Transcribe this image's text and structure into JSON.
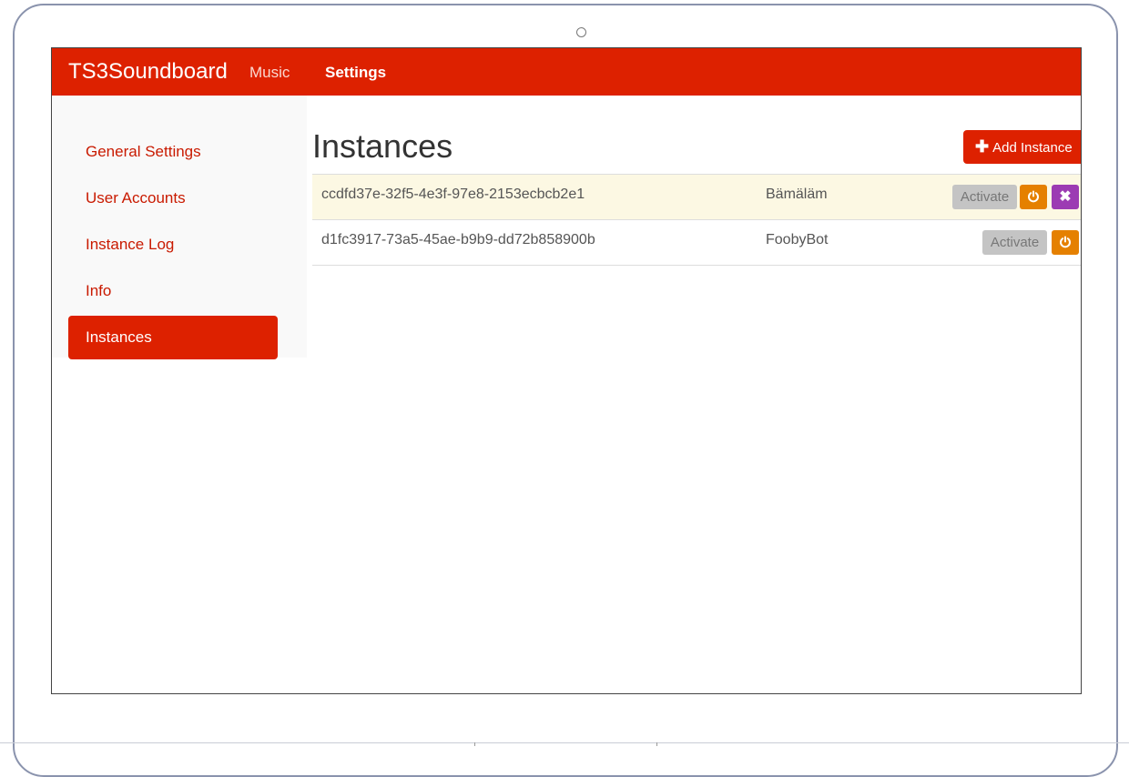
{
  "navbar": {
    "brand": "TS3Soundboard",
    "links": [
      {
        "label": "Music"
      },
      {
        "label": "Settings"
      }
    ]
  },
  "sidebar": {
    "items": [
      {
        "label": "General Settings"
      },
      {
        "label": "User Accounts"
      },
      {
        "label": "Instance Log"
      },
      {
        "label": "Info"
      },
      {
        "label": "Instances",
        "active": true
      }
    ]
  },
  "main": {
    "title": "Instances",
    "add_button_label": "Add Instance",
    "instances": [
      {
        "id": "ccdfd37e-32f5-4e3f-97e8-2153ecbcb2e1",
        "name": "Bämäläm",
        "activate_label": "Activate",
        "has_delete": true
      },
      {
        "id": "d1fc3917-73a5-45ae-b9b9-dd72b858900b",
        "name": "FoobyBot",
        "activate_label": "Activate",
        "has_delete": false
      }
    ]
  },
  "icons": {
    "add": "plus-icon",
    "power": "power-icon",
    "delete": "times-icon"
  },
  "colors": {
    "brand": "#dd2100",
    "warning_row": "#fcf8e3",
    "power_button": "#e58000",
    "delete_button": "#9c3bb3",
    "activate_button": "#c4c4c4"
  }
}
